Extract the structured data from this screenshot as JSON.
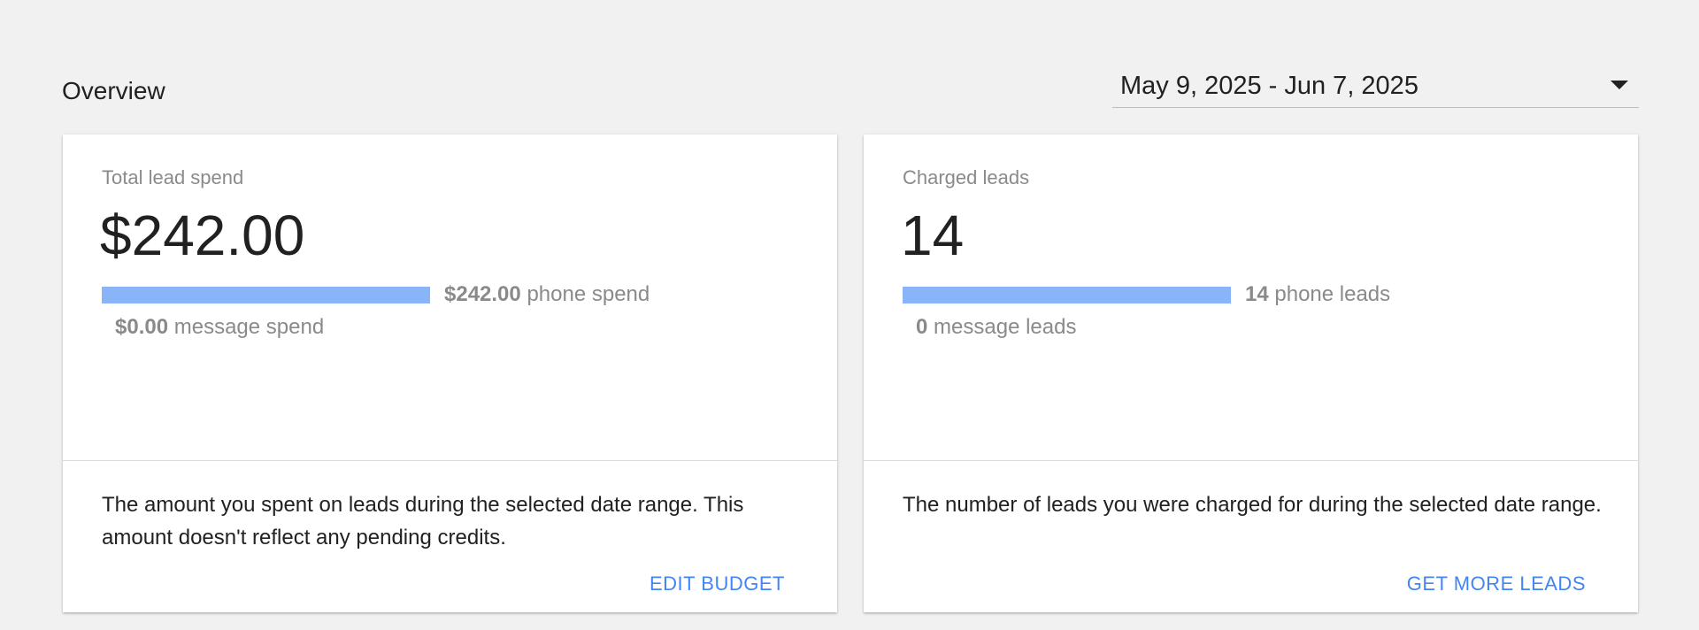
{
  "overview": {
    "title": "Overview"
  },
  "date_range": {
    "value": "May 9, 2025 - Jun 7, 2025",
    "icon": "caret-down-icon"
  },
  "colors": {
    "bar": "#8ab4f8",
    "action": "#4285f4",
    "muted_text": "#8a8a8a",
    "background": "#f1f1f1"
  },
  "cards": {
    "spend": {
      "label": "Total lead spend",
      "value": "$242.00",
      "phone_amount": "$242.00",
      "phone_label": "phone spend",
      "phone_fraction": 1.0,
      "message_amount": "$0.00",
      "message_label": "message spend",
      "description": "The amount you spent on leads during the selected date range. This amount doesn't reflect any pending credits.",
      "action_label": "EDIT BUDGET"
    },
    "leads": {
      "label": "Charged leads",
      "value": "14",
      "phone_amount": "14",
      "phone_label": "phone leads",
      "phone_fraction": 1.0,
      "message_amount": "0",
      "message_label": "message leads",
      "description": "The number of leads you were charged for during the selected date range.",
      "action_label": "GET MORE LEADS"
    }
  }
}
